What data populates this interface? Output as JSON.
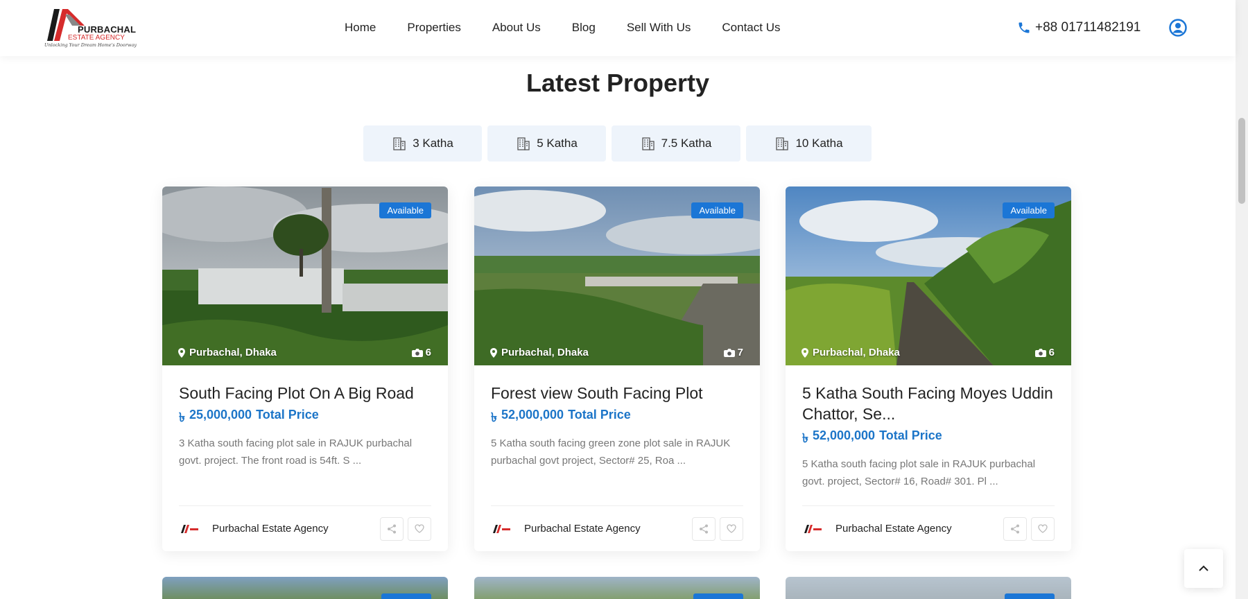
{
  "brand": {
    "name": "PURBACHAL",
    "subname": "ESTATE AGENCY",
    "tagline": "Unlocking Your Dream Home's Doorway",
    "accent_color": "#d62c2c"
  },
  "nav": {
    "items": [
      "Home",
      "Properties",
      "About Us",
      "Blog",
      "Sell With Us",
      "Contact Us"
    ]
  },
  "contact": {
    "phone": "+88 01711482191",
    "phone_icon": "phone-icon",
    "user_icon": "user-circle-icon"
  },
  "section": {
    "title": "Latest Property"
  },
  "tabs": [
    {
      "label": "3 Katha",
      "icon": "building-icon"
    },
    {
      "label": "5 Katha",
      "icon": "building-icon"
    },
    {
      "label": "7.5 Katha",
      "icon": "building-icon"
    },
    {
      "label": "10 Katha",
      "icon": "building-icon"
    }
  ],
  "cards": [
    {
      "badge": "Available",
      "location": "Purbachal, Dhaka",
      "photo_count": "6",
      "title": "South Facing Plot On A Big Road",
      "currency": "৳",
      "price": "25,000,000",
      "price_label": "Total Price",
      "description": "3 Katha south facing plot sale in RAJUK purbachal govt. project. The front road is 54ft. S ...",
      "agent": "Purbachal Estate Agency"
    },
    {
      "badge": "Available",
      "location": "Purbachal, Dhaka",
      "photo_count": "7",
      "title": "Forest view South Facing Plot",
      "currency": "৳",
      "price": "52,000,000",
      "price_label": "Total Price",
      "description": "5 Katha south facing green zone plot sale in RAJUK purbachal govt project, Sector# 25, Roa ...",
      "agent": "Purbachal Estate Agency"
    },
    {
      "badge": "Available",
      "location": "Purbachal, Dhaka",
      "photo_count": "6",
      "title": "5 Katha South Facing Moyes Uddin Chattor, Se...",
      "currency": "৳",
      "price": "52,000,000",
      "price_label": "Total Price",
      "description": "5 Katha south facing plot sale in RAJUK purbachal govt. project, Sector# 16, Road# 301. Pl ...",
      "agent": "Purbachal Estate Agency"
    }
  ],
  "colors": {
    "primary": "#1b76d6",
    "price": "#1c75c8",
    "tab_bg": "#eef4fb"
  }
}
